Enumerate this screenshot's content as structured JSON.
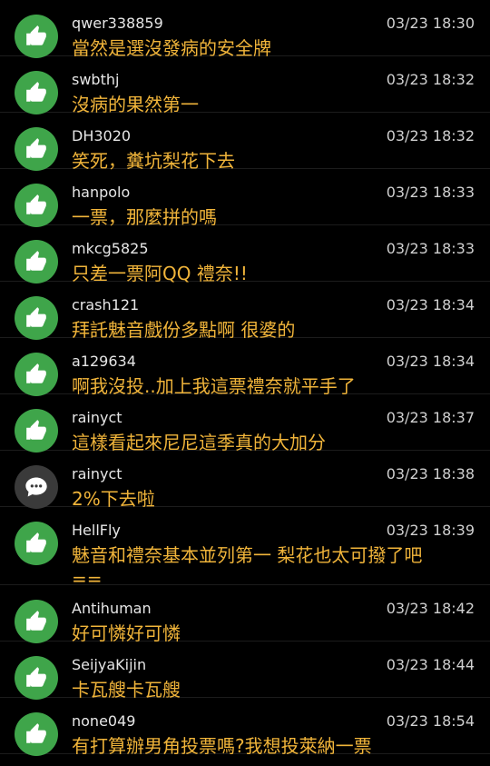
{
  "comments": [
    {
      "user": "qwer338859",
      "time": "03/23 18:30",
      "text": "當然是選沒發病的安全牌",
      "icon": "thumbs-up-icon"
    },
    {
      "user": "swbthj",
      "time": "03/23 18:32",
      "text": "沒病的果然第一",
      "icon": "thumbs-up-icon"
    },
    {
      "user": "DH3020",
      "time": "03/23 18:32",
      "text": "笑死，糞坑梨花下去",
      "icon": "thumbs-up-icon"
    },
    {
      "user": "hanpolo",
      "time": "03/23 18:33",
      "text": "一票，那麼拼的嗎",
      "icon": "thumbs-up-icon"
    },
    {
      "user": "mkcg5825",
      "time": "03/23 18:33",
      "text": "只差一票阿QQ 禮奈!!",
      "icon": "thumbs-up-icon"
    },
    {
      "user": "crash121",
      "time": "03/23 18:34",
      "text": "拜託魅音戲份多點啊 很婆的",
      "icon": "thumbs-up-icon"
    },
    {
      "user": "a129634",
      "time": "03/23 18:34",
      "text": "啊我沒投..加上我這票禮奈就平手了",
      "icon": "thumbs-up-icon"
    },
    {
      "user": "rainyct",
      "time": "03/23 18:37",
      "text": "這樣看起來尼尼這季真的大加分",
      "icon": "thumbs-up-icon"
    },
    {
      "user": "rainyct",
      "time": "03/23 18:38",
      "text": "2%下去啦",
      "icon": "speech-bubble-icon"
    },
    {
      "user": "HellFly",
      "time": "03/23 18:39",
      "text": "魅音和禮奈基本並列第一 梨花也太可撥了吧\n==",
      "icon": "thumbs-up-icon"
    },
    {
      "user": "Antihuman",
      "time": "03/23 18:42",
      "text": "好可憐好可憐",
      "icon": "thumbs-up-icon"
    },
    {
      "user": "SeijyaKijin",
      "time": "03/23 18:44",
      "text": "卡瓦艘卡瓦艘",
      "icon": "thumbs-up-icon"
    },
    {
      "user": "none049",
      "time": "03/23 18:54",
      "text": "有打算辦男角投票嗎?我想投萊納一票",
      "icon": "thumbs-up-icon"
    }
  ],
  "colors": {
    "background": "#000000",
    "like_avatar": "#3fa54a",
    "reply_avatar": "#3a3a3a",
    "comment_text": "#f0b43a",
    "username": "#e6e6e6",
    "timestamp": "#d0d0d0"
  }
}
